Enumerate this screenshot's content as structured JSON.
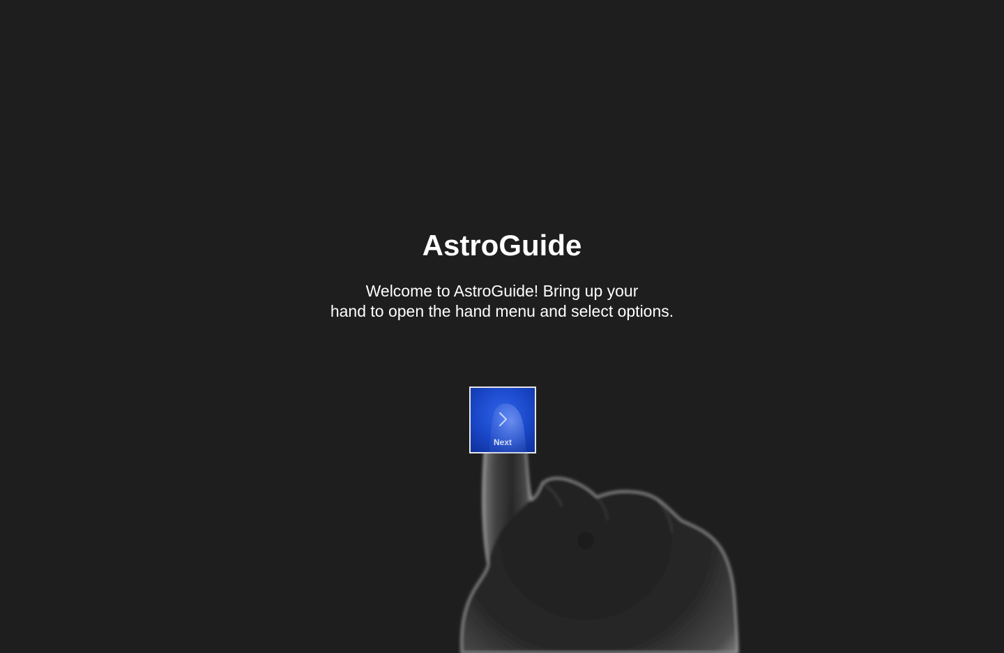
{
  "app": {
    "title": "AstroGuide"
  },
  "welcome": {
    "line1": "Welcome to AstroGuide! Bring up your",
    "line2": "hand to open the hand menu and select options."
  },
  "next_button": {
    "label": "Next",
    "icon": "chevron-right-icon",
    "color": "#1a47c8"
  },
  "hand_illustration": {
    "icon": "pointing-hand-icon"
  },
  "colors": {
    "background": "#1e1e1e",
    "text": "#ffffff",
    "accent": "#1a47c8"
  }
}
